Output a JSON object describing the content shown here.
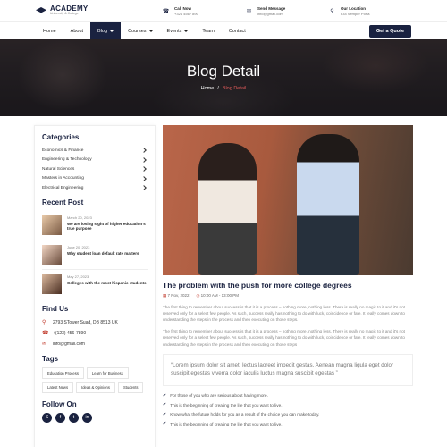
{
  "header": {
    "logo_title": "ACADEMY",
    "logo_sub": "University & College",
    "contacts": [
      {
        "icon": "phone-icon",
        "title": "Call Now",
        "value": "+324 4567 890"
      },
      {
        "icon": "mail-icon",
        "title": "Send Message",
        "value": "info@gmail.com"
      },
      {
        "icon": "location-icon",
        "title": "Our Location",
        "value": "634 Semper Porta"
      }
    ]
  },
  "nav": {
    "items": [
      "Home",
      "About",
      "Blog",
      "Courses",
      "Events",
      "Team",
      "Contact"
    ],
    "quote_label": "Get a Quote"
  },
  "hero": {
    "title": "Blog Detail",
    "crumb_home": "Home",
    "crumb_sep": "/",
    "crumb_current": "Blog Detail"
  },
  "sidebar": {
    "categories_title": "Categories",
    "categories": [
      "Economics & Finance",
      "Engineering & Technology",
      "Natural Sciences",
      "Masters in Accounting",
      "Electrical Engineering"
    ],
    "recent_title": "Recent Post",
    "posts": [
      {
        "date": "March 20, 2023",
        "title": "We are losing sight of higher education's true purpose"
      },
      {
        "date": "June 20, 2023",
        "title": "Why student loan default rate matters"
      },
      {
        "date": "May 27, 2023",
        "title": "Colleges with the most hispanic students"
      }
    ],
    "find_title": "Find Us",
    "find": [
      {
        "icon": "location-icon",
        "text": "2793 STower Suad, DB 8513 UK"
      },
      {
        "icon": "phone-icon",
        "text": "+(123) 456-7890"
      },
      {
        "icon": "mail-icon",
        "text": "info@gmail.com"
      }
    ],
    "tags_title": "Tags",
    "tags": [
      "Education Process",
      "Learn for Business",
      "Latest News",
      "Ideas & Opinions",
      "Students"
    ],
    "follow_title": "Follow On",
    "social": [
      "skype-icon",
      "facebook-icon",
      "twitter-icon",
      "linkedin-icon"
    ]
  },
  "article": {
    "title": "The problem with the push for more college degrees",
    "date": "7 Nov, 2022",
    "time": "10:00 AM - 13:00 PM",
    "para1": "The first thing to remember about success is that it is a process – nothing more, nothing less. There is really no magic to it and it's not reserved only for a select few people. As such, success really has nothing to do with luck, coincidence or fate. It really comes down to understanding the steps in the process and then executing on those steps.",
    "para2": "The first thing to remember about success is that it is a process – nothing more, nothing less. There is really no magic to it and it's not reserved only for a select few people. As such, success really has nothing to do with luck, coincidence or fate. It really comes down to understanding the steps in the process and then executing on those steps",
    "quote": "“Lorem ipsum dolor sit amet, lectus laoreet impedit gestas. Aenean magna ligula eget dolor suscipit egestas viverra dolor iaculis luctus magna suscipit egestas ”",
    "checks": [
      "For those of you who are serious about having more.",
      "This is the beginning of creating the life that you want to live.",
      "Know what the future holds for you as a result of the choice you can make today.",
      "This is the beginning of creating the life that you want to live."
    ]
  }
}
